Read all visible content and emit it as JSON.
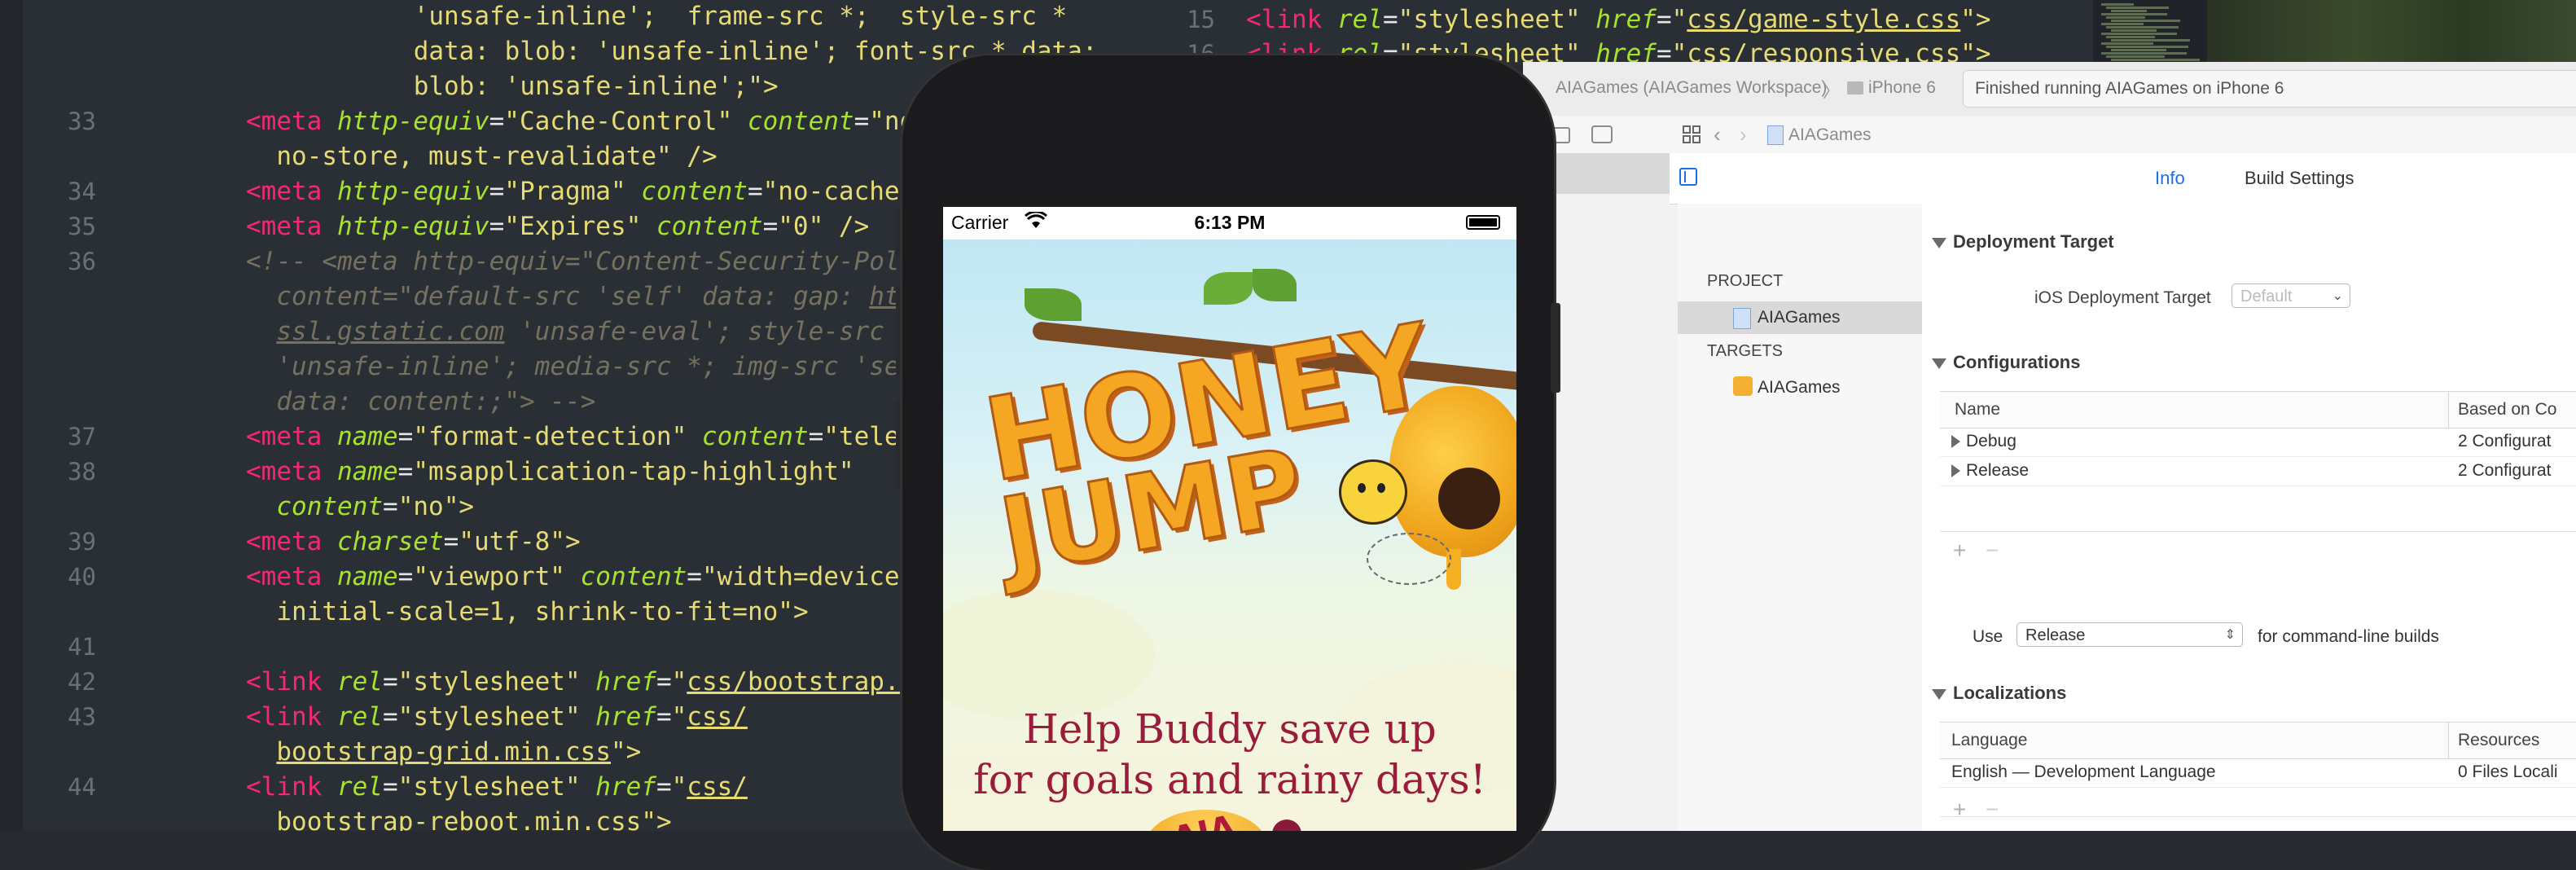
{
  "editor": {
    "lines": [
      {
        "num": "",
        "indent": 11,
        "parts": [
          [
            "str",
            "'unsafe-inline';  frame-src *;  style-src *"
          ]
        ]
      },
      {
        "num": "",
        "indent": 11,
        "parts": [
          [
            "str",
            "data: blob: 'unsafe-inline'; font-src * data:"
          ]
        ]
      },
      {
        "num": "",
        "indent": 11,
        "parts": [
          [
            "str",
            "blob: 'unsafe-inline';\">"
          ]
        ]
      },
      {
        "num": "33",
        "indent": 0,
        "parts": [
          [
            "tag",
            "<meta "
          ],
          [
            "attr",
            "http-equiv"
          ],
          [
            "txt",
            "="
          ],
          [
            "str",
            "\"Cache-Control\" "
          ],
          [
            "attr",
            "content"
          ],
          [
            "txt",
            "="
          ],
          [
            "str",
            "\"no-cach"
          ]
        ]
      },
      {
        "num": "",
        "indent": 2,
        "parts": [
          [
            "str",
            "no-store, must-revalidate\" />"
          ]
        ]
      },
      {
        "num": "34",
        "indent": 0,
        "parts": [
          [
            "tag",
            "<meta "
          ],
          [
            "attr",
            "http-equiv"
          ],
          [
            "txt",
            "="
          ],
          [
            "str",
            "\"Pragma\" "
          ],
          [
            "attr",
            "content"
          ],
          [
            "txt",
            "="
          ],
          [
            "str",
            "\"no-cache\" />"
          ]
        ]
      },
      {
        "num": "35",
        "indent": 0,
        "parts": [
          [
            "tag",
            "<meta "
          ],
          [
            "attr",
            "http-equiv"
          ],
          [
            "txt",
            "="
          ],
          [
            "str",
            "\"Expires\" "
          ],
          [
            "attr",
            "content"
          ],
          [
            "txt",
            "="
          ],
          [
            "str",
            "\"0\" />"
          ]
        ]
      },
      {
        "num": "36",
        "indent": 0,
        "parts": [
          [
            "cmt",
            "<!-- <meta http-equiv=\"Content-Security-Policy\""
          ]
        ]
      },
      {
        "num": "",
        "indent": 2,
        "parts": [
          [
            "cmt",
            "content=\"default-src 'self' data: gap: "
          ],
          [
            "cmtu",
            "https"
          ]
        ]
      },
      {
        "num": "",
        "indent": 2,
        "parts": [
          [
            "cmtu",
            "ssl.gstatic.com"
          ],
          [
            "cmt",
            " 'unsafe-eval'; style-src 's"
          ]
        ]
      },
      {
        "num": "",
        "indent": 2,
        "parts": [
          [
            "cmt",
            "'unsafe-inline'; media-src *; img-src 'self"
          ]
        ]
      },
      {
        "num": "",
        "indent": 2,
        "parts": [
          [
            "cmt",
            "data: content:;\"> -->"
          ]
        ]
      },
      {
        "num": "37",
        "indent": 0,
        "parts": [
          [
            "tag",
            "<meta "
          ],
          [
            "attr",
            "name"
          ],
          [
            "txt",
            "="
          ],
          [
            "str",
            "\"format-detection\" "
          ],
          [
            "attr",
            "content"
          ],
          [
            "txt",
            "="
          ],
          [
            "str",
            "\"telephon"
          ]
        ]
      },
      {
        "num": "38",
        "indent": 0,
        "parts": [
          [
            "tag",
            "<meta "
          ],
          [
            "attr",
            "name"
          ],
          [
            "txt",
            "="
          ],
          [
            "str",
            "\"msapplication-tap-highlight\""
          ]
        ]
      },
      {
        "num": "",
        "indent": 2,
        "parts": [
          [
            "attr",
            "content"
          ],
          [
            "txt",
            "="
          ],
          [
            "str",
            "\"no\">"
          ]
        ]
      },
      {
        "num": "39",
        "indent": 0,
        "parts": [
          [
            "tag",
            "<meta "
          ],
          [
            "attr",
            "charset"
          ],
          [
            "txt",
            "="
          ],
          [
            "str",
            "\"utf-8\">"
          ]
        ]
      },
      {
        "num": "40",
        "indent": 0,
        "parts": [
          [
            "tag",
            "<meta "
          ],
          [
            "attr",
            "name"
          ],
          [
            "txt",
            "="
          ],
          [
            "str",
            "\"viewport\" "
          ],
          [
            "attr",
            "content"
          ],
          [
            "txt",
            "="
          ],
          [
            "str",
            "\"width=device-widt"
          ]
        ]
      },
      {
        "num": "",
        "indent": 2,
        "parts": [
          [
            "str",
            "initial-scale=1, shrink-to-fit=no\">"
          ]
        ]
      },
      {
        "num": "41",
        "indent": 0,
        "parts": []
      },
      {
        "num": "42",
        "indent": 0,
        "parts": [
          [
            "tag",
            "<link "
          ],
          [
            "attr",
            "rel"
          ],
          [
            "txt",
            "="
          ],
          [
            "str",
            "\"stylesheet\" "
          ],
          [
            "attr",
            "href"
          ],
          [
            "txt",
            "="
          ],
          [
            "str",
            "\""
          ],
          [
            "href",
            "css/bootstrap.min.c"
          ]
        ]
      },
      {
        "num": "43",
        "indent": 0,
        "parts": [
          [
            "tag",
            "<link "
          ],
          [
            "attr",
            "rel"
          ],
          [
            "txt",
            "="
          ],
          [
            "str",
            "\"stylesheet\" "
          ],
          [
            "attr",
            "href"
          ],
          [
            "txt",
            "="
          ],
          [
            "str",
            "\""
          ],
          [
            "href",
            "css/"
          ]
        ]
      },
      {
        "num": "",
        "indent": 2,
        "parts": [
          [
            "href",
            "bootstrap-grid.min.css"
          ],
          [
            "str",
            "\">"
          ]
        ]
      },
      {
        "num": "44",
        "indent": 0,
        "parts": [
          [
            "tag",
            "<link "
          ],
          [
            "attr",
            "rel"
          ],
          [
            "txt",
            "="
          ],
          [
            "str",
            "\"stylesheet\" "
          ],
          [
            "attr",
            "href"
          ],
          [
            "txt",
            "="
          ],
          [
            "str",
            "\""
          ],
          [
            "href",
            "css/"
          ]
        ]
      },
      {
        "num": "",
        "indent": 2,
        "parts": [
          [
            "href",
            "bootstrap-reboot.min.css"
          ],
          [
            "str",
            "\">"
          ]
        ]
      }
    ]
  },
  "editor2": {
    "lines": [
      {
        "num": "15",
        "parts": [
          [
            "tag",
            "<link "
          ],
          [
            "attr",
            "rel"
          ],
          [
            "txt",
            "="
          ],
          [
            "str",
            "\"stylesheet\" "
          ],
          [
            "attr",
            "href"
          ],
          [
            "txt",
            "="
          ],
          [
            "str",
            "\""
          ],
          [
            "href",
            "css/game-style.css"
          ],
          [
            "str",
            "\">"
          ]
        ]
      },
      {
        "num": "16",
        "parts": [
          [
            "tag",
            "<link "
          ],
          [
            "attr",
            "rel"
          ],
          [
            "txt",
            "="
          ],
          [
            "str",
            "\"stylesheet\" "
          ],
          [
            "attr",
            "href"
          ],
          [
            "txt",
            "="
          ],
          [
            "str",
            "\""
          ],
          [
            "href",
            "css/responsive.css"
          ],
          [
            "str",
            "\">"
          ]
        ]
      }
    ]
  },
  "xcode": {
    "breadcrumb_workspace": "AIAGames (AIAGames Workspace)",
    "breadcrumb_device": "iPhone 6",
    "status": "Finished running AIAGames on iPhone 6",
    "jump_file": "AIAGames",
    "tabs": {
      "info": "Info",
      "build_settings": "Build Settings"
    },
    "sidebar": {
      "project_header": "PROJECT",
      "project_item": "AIAGames",
      "targets_header": "TARGETS",
      "target_item": "AIAGames"
    },
    "deployment": {
      "title": "Deployment Target",
      "label": "iOS Deployment Target",
      "value": "Default"
    },
    "configurations": {
      "title": "Configurations",
      "col_name": "Name",
      "col_based": "Based on Co",
      "rows": [
        {
          "name": "Debug",
          "based": "2 Configurat"
        },
        {
          "name": "Release",
          "based": "2 Configurat"
        }
      ],
      "use_label": "Use",
      "use_value": "Release",
      "use_suffix": "for command-line builds",
      "plus": "+",
      "minus": "−"
    },
    "localizations": {
      "title": "Localizations",
      "col_language": "Language",
      "col_resources": "Resources",
      "rows": [
        {
          "language": "English — Development Language",
          "resources": "0 Files Locali"
        }
      ],
      "plus": "+",
      "minus": "−"
    }
  },
  "phone": {
    "carrier": "Carrier",
    "time": "6:13 PM",
    "game": {
      "logo_line1": "HONEY",
      "logo_line2": "JUMP",
      "tagline_line1": "Help Buddy save up",
      "tagline_line2": "for goals and rainy days!",
      "badge_text": "AIA"
    }
  },
  "colors": {
    "editor_bg": "#2a2f36",
    "tag": "#f92672",
    "attr": "#a6e22e",
    "string": "#e6db74",
    "comment": "#75715e",
    "tagline": "#9b1b3b",
    "xcode_blue": "#1d6fe0"
  }
}
